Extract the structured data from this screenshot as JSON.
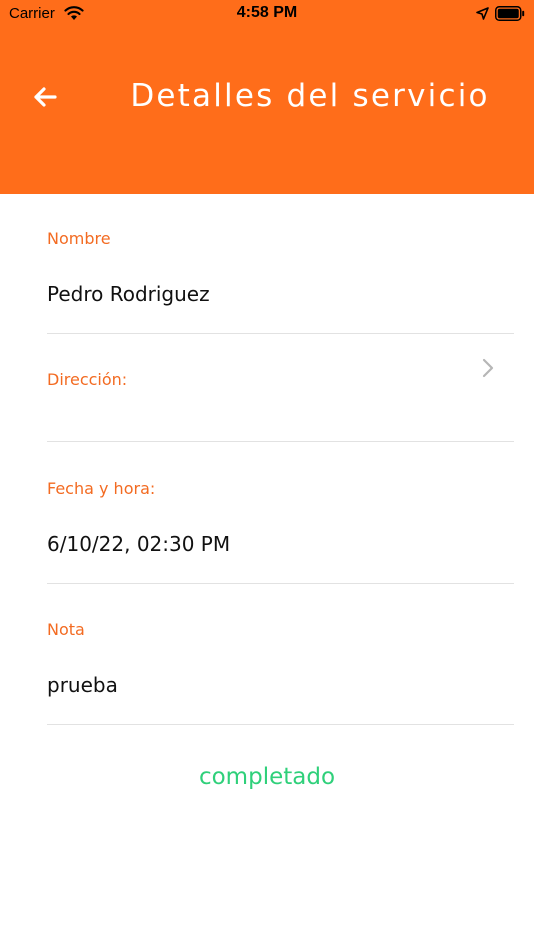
{
  "status_bar": {
    "carrier": "Carrier",
    "time": "4:58 PM"
  },
  "header": {
    "title": "Detalles del servicio",
    "back_icon": "arrow-left-icon",
    "background_color": "#ff6d1a"
  },
  "fields": {
    "nombre": {
      "label": "Nombre",
      "value": "Pedro Rodriguez"
    },
    "direccion": {
      "label": "Dirección:",
      "value": ""
    },
    "fecha": {
      "label": "Fecha y hora:",
      "value": "6/10/22, 02:30 PM"
    },
    "nota": {
      "label": "Nota",
      "value": "prueba"
    }
  },
  "service_status": {
    "text": "completado",
    "color": "#2fd07a"
  },
  "colors": {
    "accent": "#f36b22",
    "divider": "#e2e2e2"
  }
}
